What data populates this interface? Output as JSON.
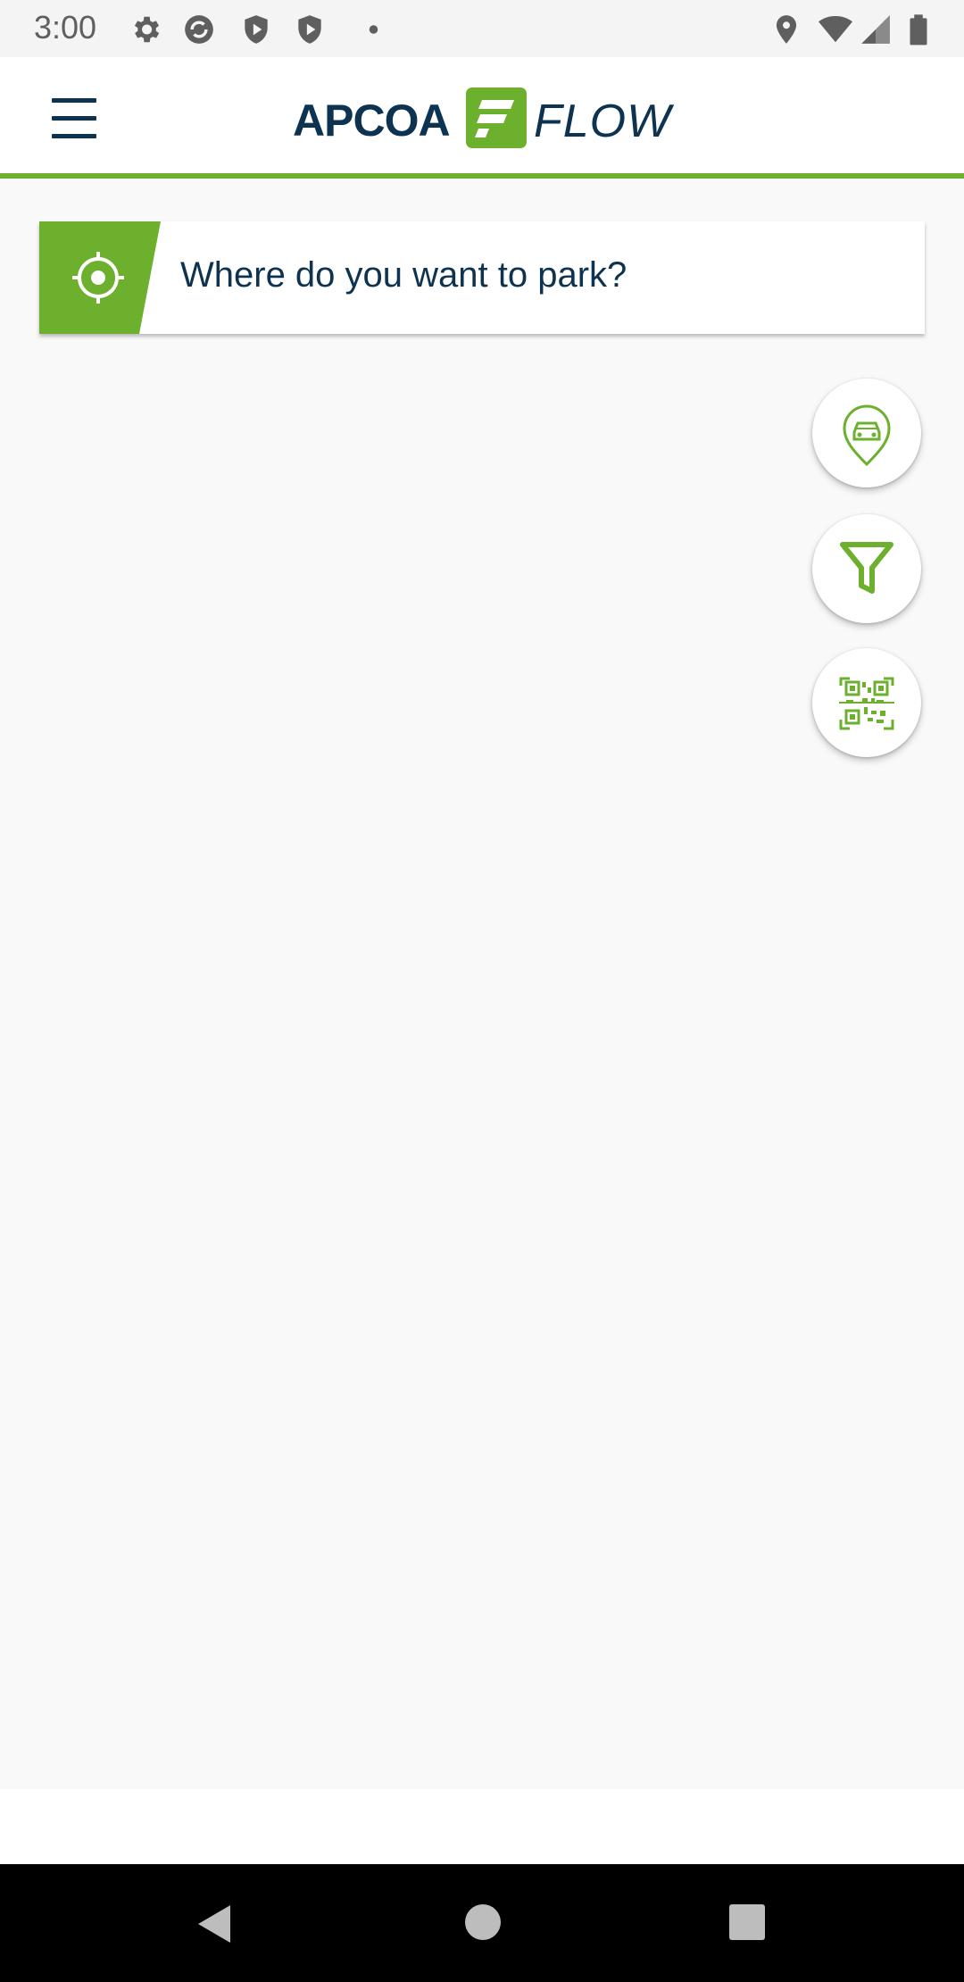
{
  "status_bar": {
    "time": "3:00",
    "icons_left": [
      "settings-icon",
      "sync-icon",
      "shield-play-icon",
      "shield-play-icon",
      "dot-icon"
    ],
    "icons_right": [
      "location-icon",
      "wifi-icon",
      "signal-icon",
      "battery-icon"
    ]
  },
  "header": {
    "logo_text_left": "APCOA",
    "logo_text_right": "FLOW",
    "menu_icon": "hamburger-menu-icon"
  },
  "search": {
    "placeholder": "Where do you want to park?",
    "locate_icon": "crosshair-icon"
  },
  "fabs": [
    {
      "name": "parked-car-location-button",
      "icon": "car-pin-icon"
    },
    {
      "name": "filter-button",
      "icon": "filter-icon"
    },
    {
      "name": "qr-scan-button",
      "icon": "qr-code-icon"
    }
  ],
  "navigation": {
    "buttons": [
      "back-icon",
      "home-icon",
      "recents-icon"
    ]
  },
  "colors": {
    "brand_green": "#6cb02d",
    "brand_navy": "#0d3350",
    "map_bg": "#f9f9f9"
  }
}
